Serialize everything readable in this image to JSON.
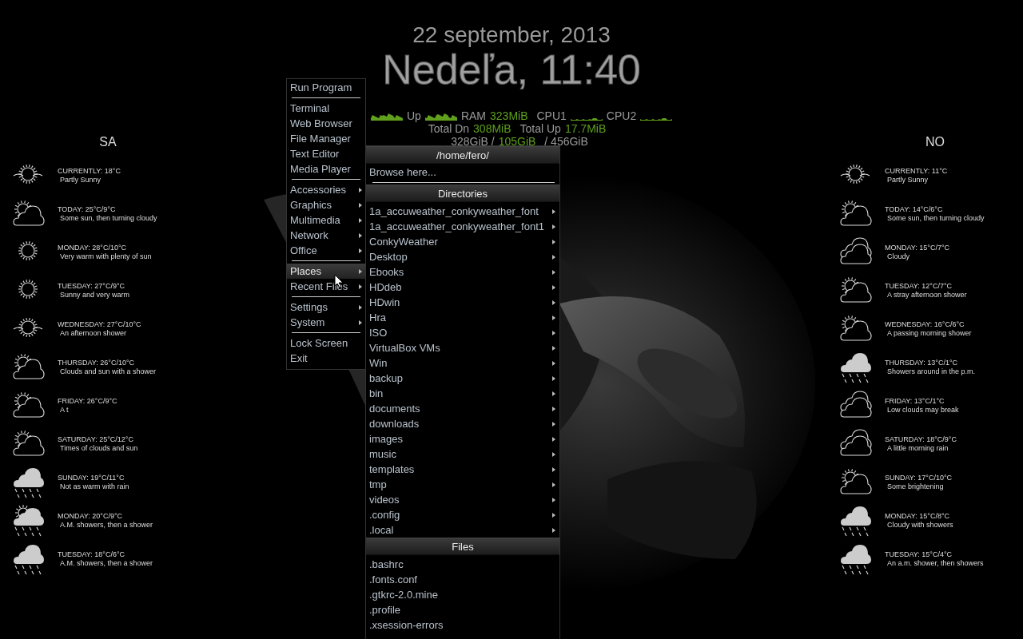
{
  "clock": {
    "date": "22 september, 2013",
    "time": "Nedeľa, 11:40"
  },
  "stats": {
    "rows": [
      [
        {
          "kind": "graph"
        },
        {
          "kind": "label",
          "text": "Up"
        },
        {
          "kind": "graph"
        },
        {
          "kind": "label",
          "text": "RAM"
        },
        {
          "kind": "value",
          "text": "323MiB"
        },
        {
          "kind": "label",
          "text": "CPU1"
        },
        {
          "kind": "flat-graph"
        },
        {
          "kind": "label",
          "text": "CPU2"
        },
        {
          "kind": "flat-graph"
        }
      ],
      [
        {
          "kind": "label",
          "text": "Total Dn"
        },
        {
          "kind": "value",
          "text": "308MiB"
        },
        {
          "kind": "label",
          "text": "Total Up"
        },
        {
          "kind": "value",
          "text": "17.7MiB"
        }
      ],
      [
        {
          "kind": "label",
          "text": "328GiB /"
        },
        {
          "kind": "value",
          "text": "105GiB"
        },
        {
          "kind": "label",
          "text": "/ 456GiB"
        }
      ]
    ]
  },
  "weather": [
    {
      "title": "SA",
      "days": [
        {
          "kind": "haze",
          "heading": "CURRENTLY: 18°C",
          "summary": "Partly Sunny"
        },
        {
          "kind": "sun-cloud",
          "heading": "TODAY: 25°C/9°C",
          "summary": "Some sun, then turning cloudy"
        },
        {
          "kind": "sun",
          "heading": "MONDAY: 28°C/10°C",
          "summary": "Very warm with plenty of sun"
        },
        {
          "kind": "sun",
          "heading": "TUESDAY: 27°C/9°C",
          "summary": "Sunny and very warm"
        },
        {
          "kind": "haze",
          "heading": "WEDNESDAY: 27°C/10°C",
          "summary": "An afternoon shower"
        },
        {
          "kind": "sun-cloud",
          "heading": "THURSDAY: 26°C/10°C",
          "summary": "Clouds and sun with a shower"
        },
        {
          "kind": "sun-cloud",
          "heading": "FRIDAY: 26°C/9°C",
          "summary": "A t"
        },
        {
          "kind": "sun-cloud",
          "heading": "SATURDAY: 25°C/12°C",
          "summary": "Times of clouds and sun"
        },
        {
          "kind": "rain",
          "heading": "SUNDAY: 19°C/11°C",
          "summary": "Not as warm with rain"
        },
        {
          "kind": "sun-rain",
          "heading": "MONDAY: 20°C/9°C",
          "summary": "A.M. showers, then a shower"
        },
        {
          "kind": "rain",
          "heading": "TUESDAY: 18°C/6°C",
          "summary": "A.M. showers, then a shower"
        }
      ]
    },
    {
      "title": "NO",
      "days": [
        {
          "kind": "haze",
          "heading": "CURRENTLY: 11°C",
          "summary": "Partly Sunny"
        },
        {
          "kind": "sun-cloud",
          "heading": "TODAY: 14°C/6°C",
          "summary": "Some sun, then turning cloudy"
        },
        {
          "kind": "clouds",
          "heading": "MONDAY: 15°C/7°C",
          "summary": "Cloudy"
        },
        {
          "kind": "sun-cloud",
          "heading": "TUESDAY: 12°C/7°C",
          "summary": "A stray afternoon shower"
        },
        {
          "kind": "sun-cloud",
          "heading": "WEDNESDAY: 16°C/6°C",
          "summary": "A passing morning shower"
        },
        {
          "kind": "rain",
          "heading": "THURSDAY: 13°C/1°C",
          "summary": "Showers around in the p.m."
        },
        {
          "kind": "clouds",
          "heading": "FRIDAY: 13°C/1°C",
          "summary": "Low clouds may break"
        },
        {
          "kind": "clouds",
          "heading": "SATURDAY: 18°C/9°C",
          "summary": "A little morning rain"
        },
        {
          "kind": "sun-cloud",
          "heading": "SUNDAY: 17°C/10°C",
          "summary": "Some brightening"
        },
        {
          "kind": "rain",
          "heading": "MONDAY: 15°C/8°C",
          "summary": "Cloudy with showers"
        },
        {
          "kind": "rain",
          "heading": "TUESDAY: 15°C/4°C",
          "summary": "An a.m. shower, then showers"
        }
      ]
    }
  ],
  "menu": {
    "items": [
      {
        "kind": "item",
        "label": "Run Program",
        "selected": false
      },
      {
        "kind": "separator"
      },
      {
        "kind": "item",
        "label": "Terminal",
        "selected": false
      },
      {
        "kind": "item",
        "label": "Web Browser",
        "selected": false
      },
      {
        "kind": "item",
        "label": "File Manager",
        "selected": false
      },
      {
        "kind": "item",
        "label": "Text Editor",
        "selected": false
      },
      {
        "kind": "item",
        "label": "Media Player",
        "selected": false
      },
      {
        "kind": "separator"
      },
      {
        "kind": "submenu",
        "label": "Accessories",
        "selected": false
      },
      {
        "kind": "submenu",
        "label": "Graphics",
        "selected": false
      },
      {
        "kind": "submenu",
        "label": "Multimedia",
        "selected": false
      },
      {
        "kind": "submenu",
        "label": "Network",
        "selected": false
      },
      {
        "kind": "submenu",
        "label": "Office",
        "selected": false
      },
      {
        "kind": "separator"
      },
      {
        "kind": "submenu",
        "label": "Places",
        "selected": true
      },
      {
        "kind": "submenu",
        "label": "Recent Files",
        "selected": false
      },
      {
        "kind": "separator"
      },
      {
        "kind": "submenu",
        "label": "Settings",
        "selected": false
      },
      {
        "kind": "submenu",
        "label": "System",
        "selected": false
      },
      {
        "kind": "separator"
      },
      {
        "kind": "item",
        "label": "Lock Screen",
        "selected": false
      },
      {
        "kind": "item",
        "label": "Exit",
        "selected": false
      }
    ]
  },
  "places": {
    "title": "/home/fero/",
    "browse": "Browse here...",
    "sections": [
      {
        "title": "Directories",
        "has_submenus": true,
        "items": [
          "1a_accuweather_conkyweather_font",
          "1a_accuweather_conkyweather_font1",
          "ConkyWeather",
          "Desktop",
          "Ebooks",
          "HDdeb",
          "HDwin",
          "Hra",
          "ISO",
          "VirtualBox VMs",
          "Win",
          "backup",
          "bin",
          "documents",
          "downloads",
          "images",
          "music",
          "templates",
          "tmp",
          "videos",
          ".config",
          ".local"
        ]
      },
      {
        "title": "Files",
        "has_submenus": false,
        "items": [
          ".bashrc",
          ".fonts.conf",
          ".gtkrc-2.0.mine",
          ".profile",
          ".xsession-errors"
        ]
      }
    ]
  }
}
